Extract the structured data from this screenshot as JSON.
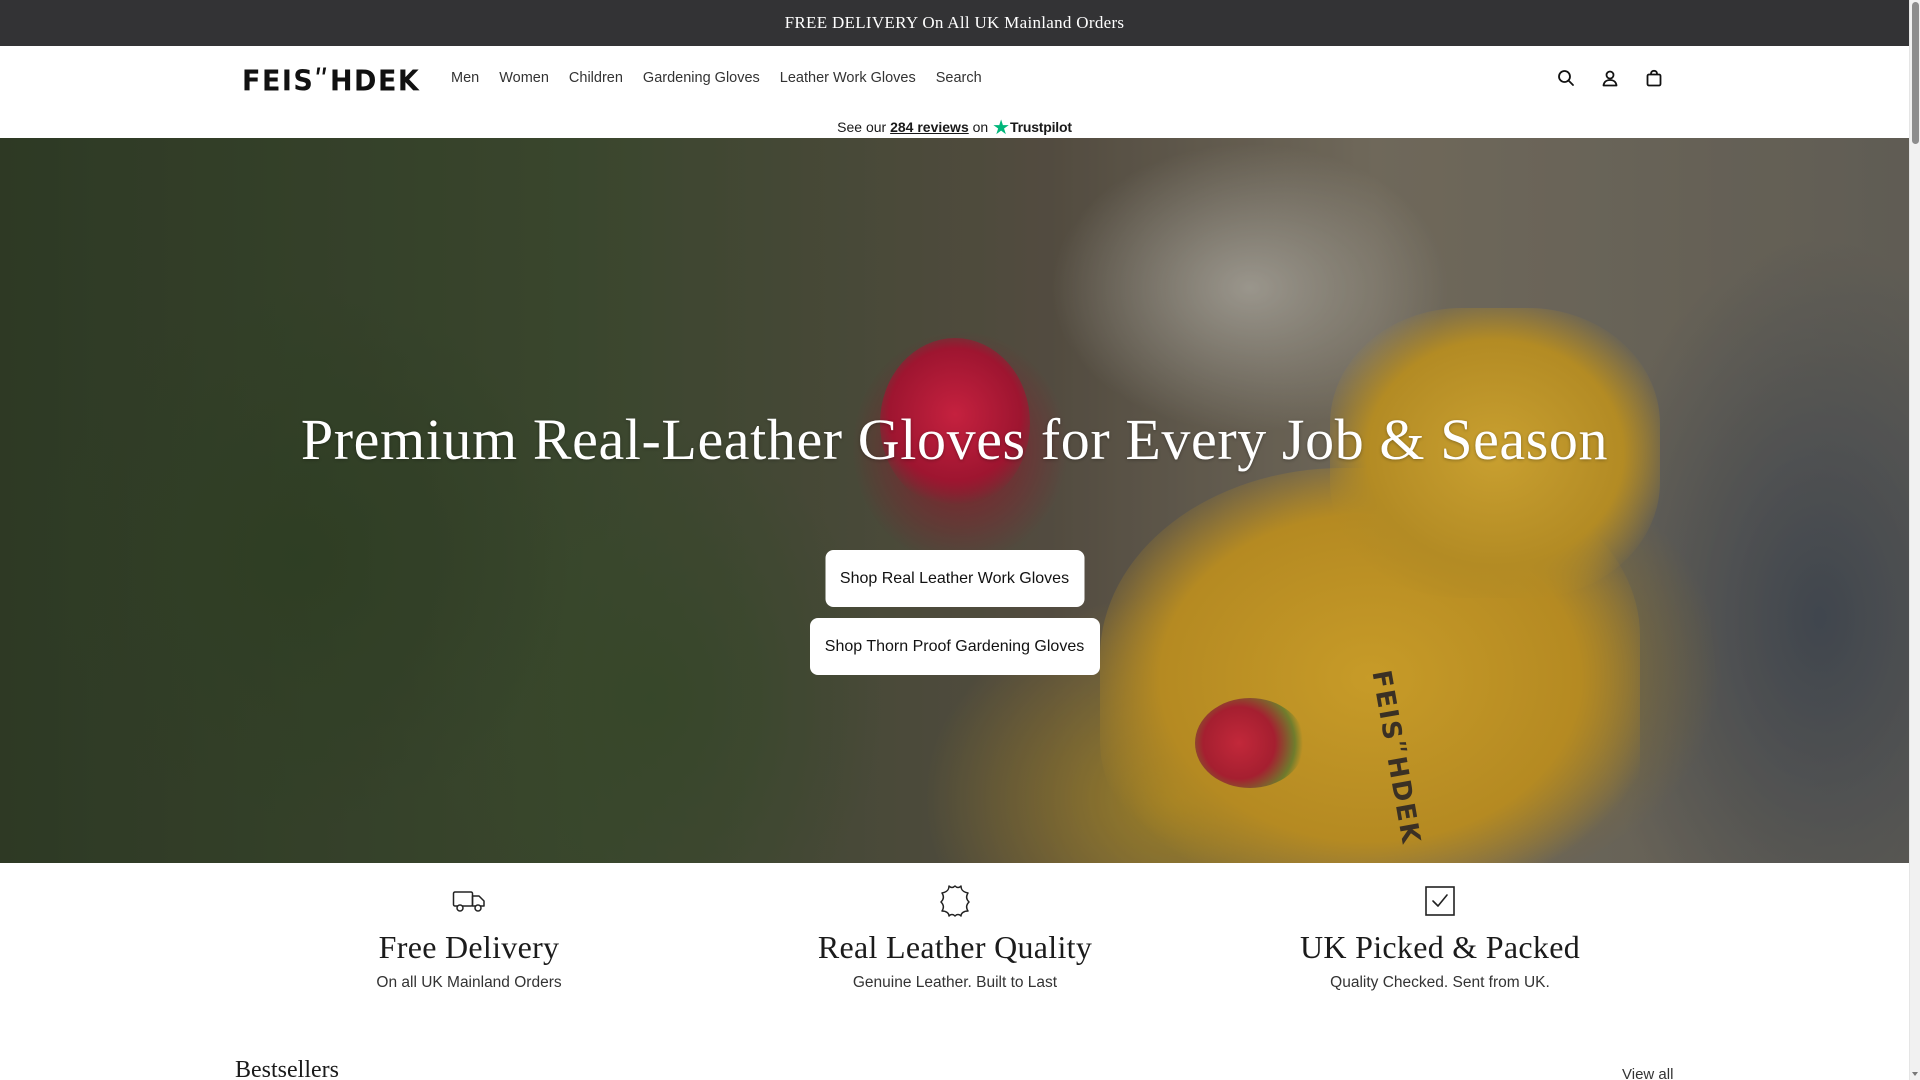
{
  "announcement": {
    "text": "FREE DELIVERY On All UK Mainland Orders"
  },
  "header": {
    "logo_text": "FEISʺHDEK",
    "nav": [
      {
        "label": "Men"
      },
      {
        "label": "Women"
      },
      {
        "label": "Children"
      },
      {
        "label": "Gardening Gloves"
      },
      {
        "label": "Leather Work Gloves"
      },
      {
        "label": "Search"
      }
    ],
    "icons": [
      "search-icon",
      "account-icon",
      "cart-icon"
    ]
  },
  "trustpilot": {
    "prefix": "See our",
    "link": "284 reviews",
    "middle": "on",
    "brand": "Trustpilot",
    "star": "★",
    "color": "#00b67a"
  },
  "hero": {
    "heading": "Premium Real-Leather Gloves for Every Job & Season",
    "buttons": [
      {
        "label": "Shop Real Leather Work Gloves"
      },
      {
        "label": "Shop Thorn Proof Gardening Gloves"
      }
    ],
    "glove_print": "FEISʺHDEK"
  },
  "features": [
    {
      "icon": "delivery-truck-icon",
      "title": "Free Delivery",
      "subtitle": "On all UK Mainland Orders"
    },
    {
      "icon": "leather-hide-icon",
      "title": "Real Leather Quality",
      "subtitle": "Genuine Leather. Built to Last"
    },
    {
      "icon": "checkbox-icon",
      "title": "UK Picked & Packed",
      "subtitle": "Quality Checked. Sent from UK."
    }
  ],
  "bestsellers": {
    "title": "Bestsellers",
    "view_all": "View all"
  },
  "colors": {
    "announcement_bg": "#333335",
    "button_bg": "#ffffff",
    "text": "#121212"
  }
}
